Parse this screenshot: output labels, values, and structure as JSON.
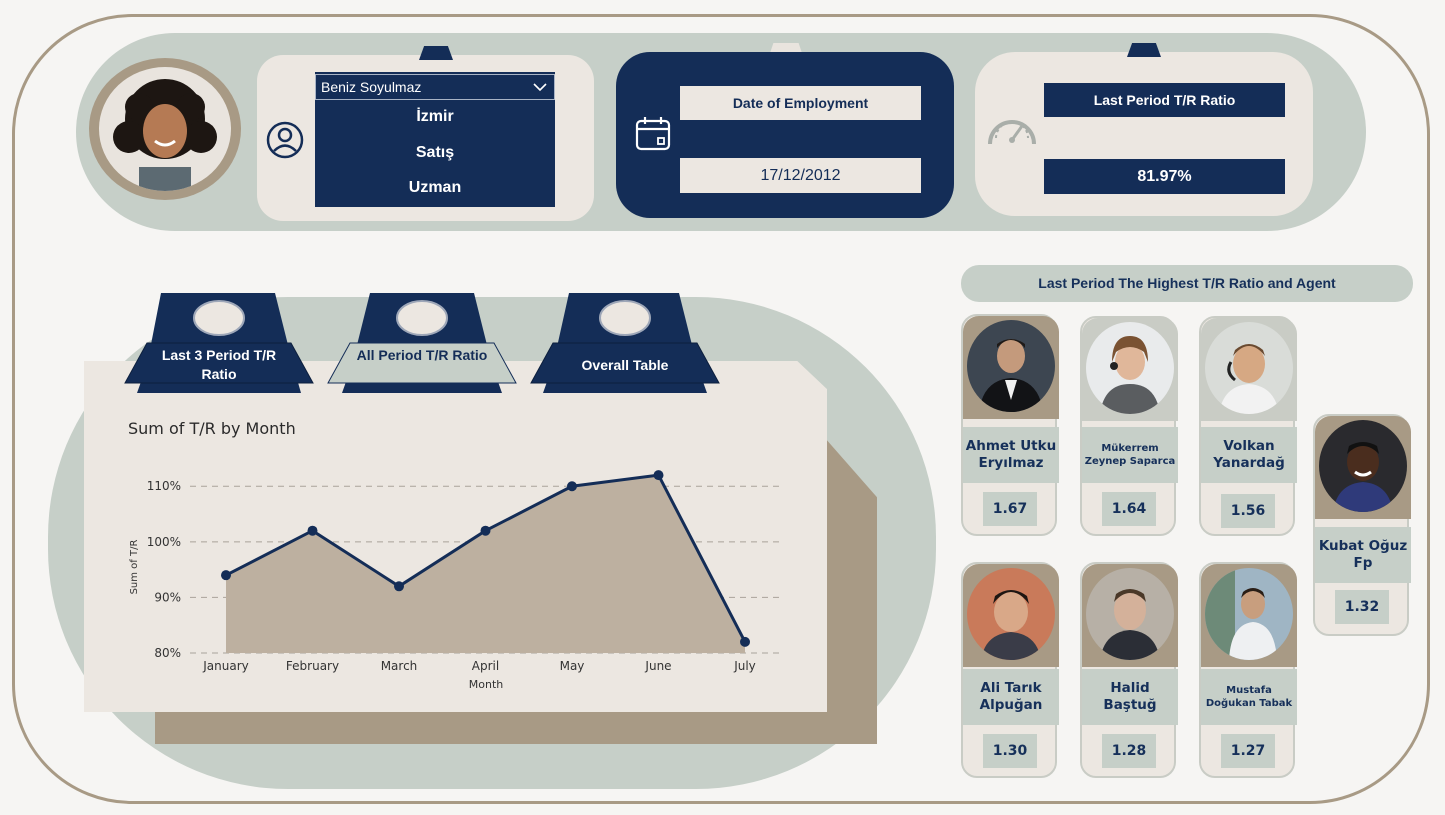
{
  "employee": {
    "name": "Beniz Soyulmaz",
    "city": "İzmir",
    "department": "Satış",
    "title": "Uzman"
  },
  "employment": {
    "label": "Date of Employment",
    "date": "17/12/2012"
  },
  "ratio": {
    "label": "Last Period T/R Ratio",
    "value": "81.97%"
  },
  "tabs": [
    {
      "label": "Last 3 Period T/R Ratio"
    },
    {
      "label": "All Period T/R Ratio"
    },
    {
      "label": "Overall Table"
    }
  ],
  "chart_data": {
    "type": "area",
    "title": "Sum of T/R by Month",
    "xlabel": "Month",
    "ylabel": "Sum of T/R",
    "categories": [
      "January",
      "February",
      "March",
      "April",
      "May",
      "June",
      "July"
    ],
    "values": [
      94,
      102,
      92,
      102,
      110,
      112,
      82
    ],
    "yticks": [
      "80%",
      "90%",
      "100%",
      "110%"
    ],
    "ylim": [
      80,
      114
    ],
    "grid": true,
    "colors": {
      "line": "#142d57",
      "fill": "#bdb0a0"
    }
  },
  "agents_panel": {
    "title": "Last Period The Highest T/R Ratio and Agent",
    "agents": [
      {
        "name": "Ahmet Utku Eryılmaz",
        "score": "1.67"
      },
      {
        "name": "Mükerrem Zeynep Saparca",
        "score": "1.64"
      },
      {
        "name": "Volkan Yanardağ",
        "score": "1.56"
      },
      {
        "name": "Kubat Oğuz Fp",
        "score": "1.32"
      },
      {
        "name": "Ali Tarık Alpuğan",
        "score": "1.30"
      },
      {
        "name": "Halid Baştuğ",
        "score": "1.28"
      },
      {
        "name": "Mustafa Doğukan Tabak",
        "score": "1.27"
      }
    ]
  },
  "colors": {
    "navy": "#142d57",
    "cream": "#ece7e1",
    "sage": "#c6cfc8",
    "tan": "#a89a85"
  }
}
